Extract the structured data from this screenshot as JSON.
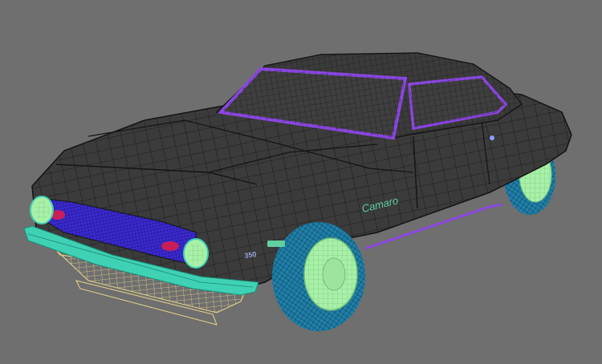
{
  "viewport": {
    "background": "#6f6f6f",
    "wire_color": "#141414",
    "body_color": "#3b3b3b",
    "glass_color": "#8a46e0",
    "tire_color": "#1f7fa8",
    "rim_color": "#a8f0a8",
    "chrome_color": "#3fd1b4",
    "grille_color": "#3a2ad0",
    "ghost_color": "#e8d58a",
    "taillight_color": "#c81e5a",
    "badge_color": "#5fd1a0"
  },
  "model": {
    "badge_model": "Camaro",
    "badge_engine": "350"
  }
}
